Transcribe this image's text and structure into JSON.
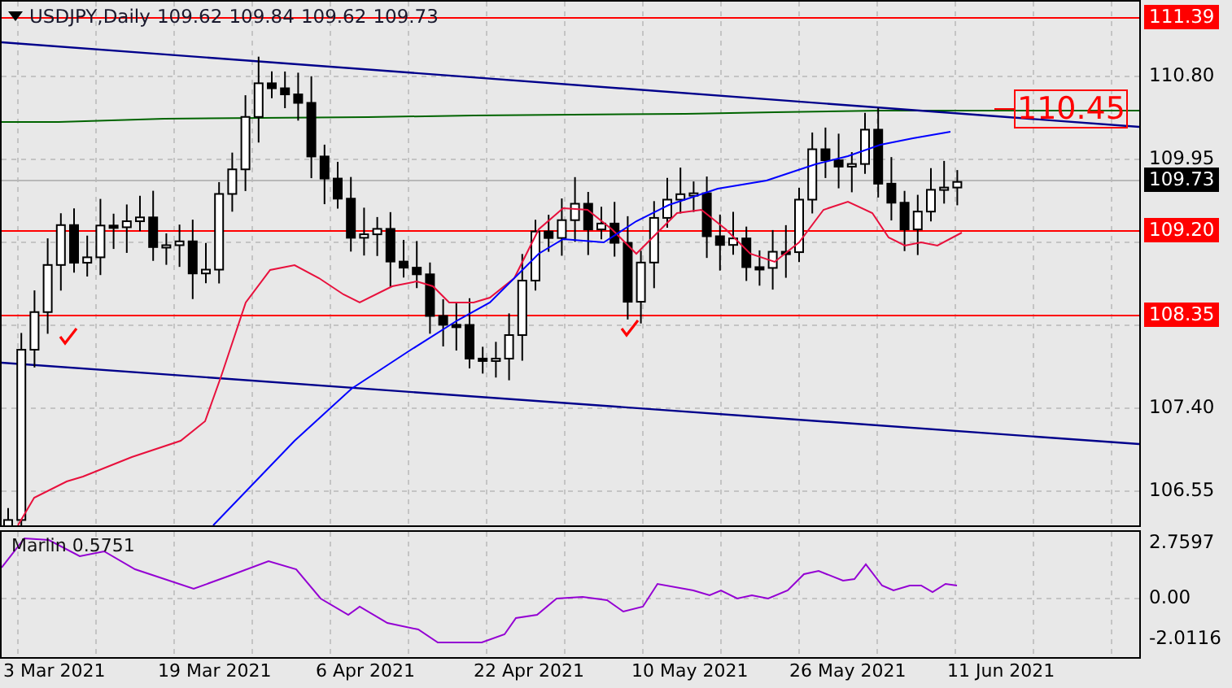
{
  "chart_header": {
    "symbol": "USDJPY,Daily",
    "prices": [
      "109.62",
      "109.84",
      "109.62",
      "109.73"
    ]
  },
  "annotation": {
    "label": "110.45"
  },
  "price_axis": [
    {
      "label": "111.39",
      "kind": "level"
    },
    {
      "label": "110.80",
      "kind": "tick"
    },
    {
      "label": "109.95",
      "kind": "tick"
    },
    {
      "label": "109.73",
      "kind": "current"
    },
    {
      "label": "109.20",
      "kind": "level"
    },
    {
      "label": "108.35",
      "kind": "level"
    },
    {
      "label": "107.40",
      "kind": "tick"
    },
    {
      "label": "106.55",
      "kind": "tick"
    }
  ],
  "indicator": {
    "name": "Marlin 0.5751",
    "axis": [
      "2.7597",
      "0.00",
      "-2.0116"
    ]
  },
  "date_axis": [
    "3 Mar 2021",
    "19 Mar 2021",
    "6 Apr 2021",
    "22 Apr 2021",
    "10 May 2021",
    "26 May 2021",
    "11 Jun 2021"
  ]
}
